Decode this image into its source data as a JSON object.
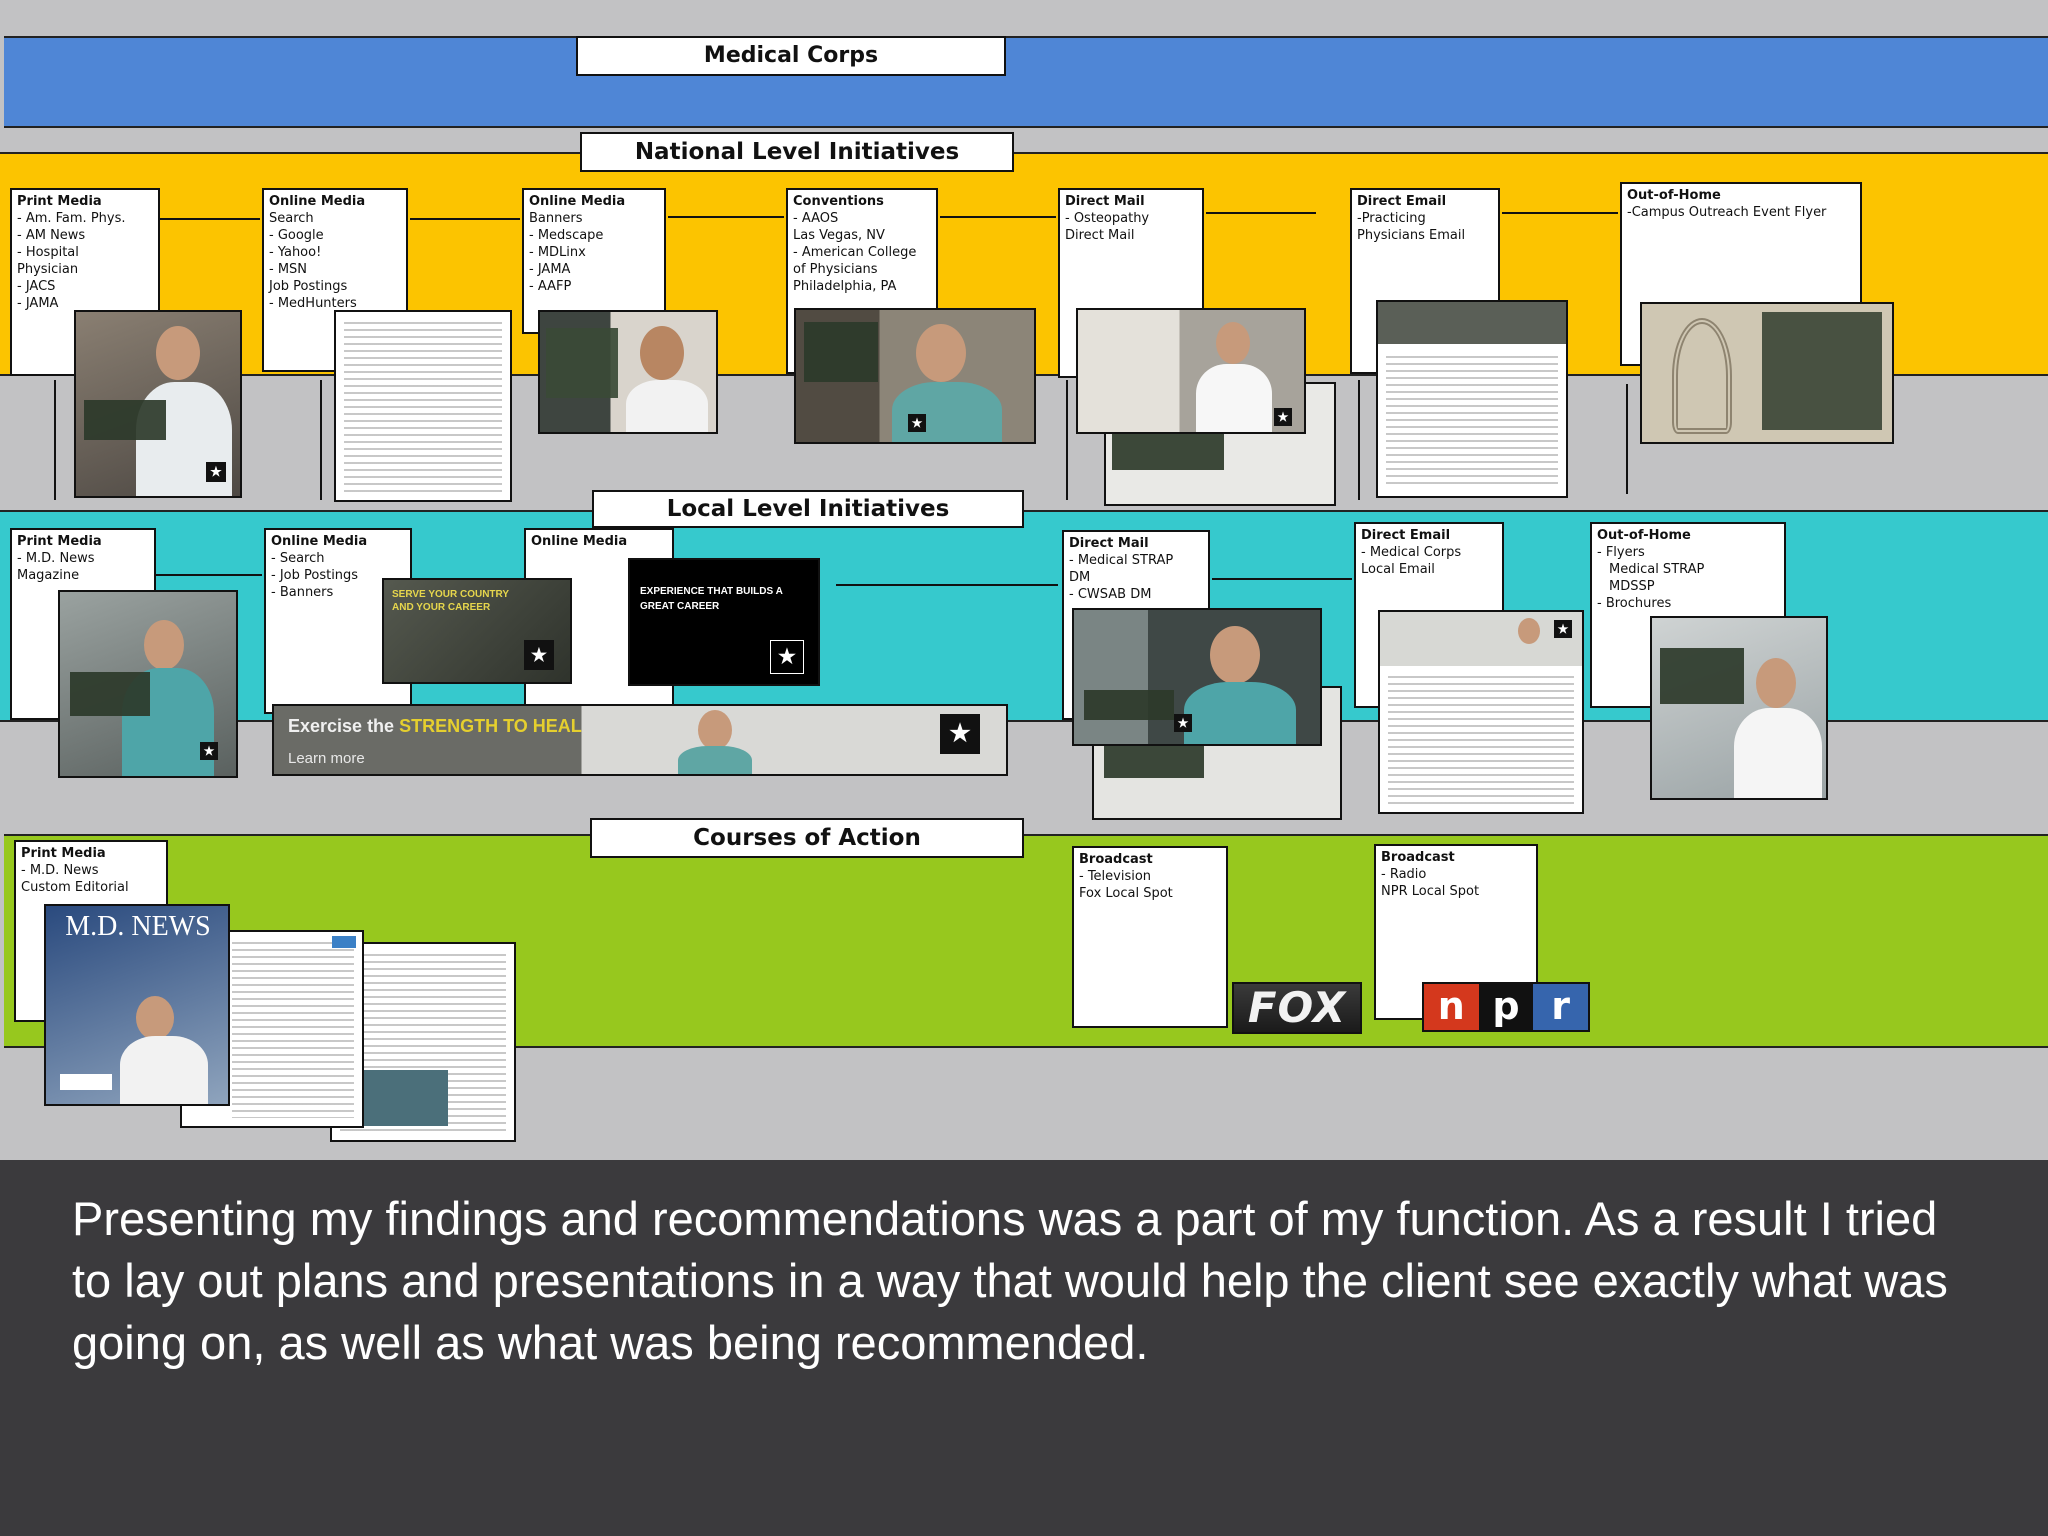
{
  "header": {
    "title": "Medical Corps"
  },
  "colors": {
    "blue": "#4f86d6",
    "yellow": "#fcc400",
    "teal": "#36c9cd",
    "green": "#97c81e",
    "panel_gray": "#c2c2c4",
    "background": "#3b3a3d"
  },
  "national": {
    "title": "National Level Initiatives",
    "print": {
      "heading": "Print Media",
      "lines": [
        "- Am. Fam. Phys.",
        "- AM News",
        "- Hospital",
        "Physician",
        "- JACS",
        "- JAMA"
      ]
    },
    "online1": {
      "heading": "Online Media",
      "lines": [
        "Search",
        "- Google",
        "- Yahoo!",
        "- MSN",
        "Job Postings",
        "- MedHunters"
      ]
    },
    "online2": {
      "heading": "Online Media",
      "lines": [
        "Banners",
        "- Medscape",
        "- MDLinx",
        "- JAMA",
        "- AAFP"
      ]
    },
    "conventions": {
      "heading": "Conventions",
      "lines": [
        "- AAOS",
        "Las Vegas, NV",
        "- American College",
        "of Physicians",
        "Philadelphia, PA"
      ]
    },
    "direct_mail": {
      "heading": "Direct Mail",
      "lines": [
        "- Osteopathy",
        "Direct Mail"
      ]
    },
    "direct_email": {
      "heading": "Direct Email",
      "lines": [
        "-Practicing",
        "Physicians Email"
      ]
    },
    "ooh": {
      "heading": "Out-of-Home",
      "lines": [
        "-Campus Outreach Event Flyer"
      ]
    }
  },
  "local": {
    "title": "Local Level Initiatives",
    "print": {
      "heading": "Print Media",
      "lines": [
        "- M.D. News",
        "Magazine"
      ]
    },
    "online1": {
      "heading": "Online Media",
      "lines": [
        "- Search",
        "- Job Postings",
        "- Banners"
      ]
    },
    "online2": {
      "heading": "Online Media",
      "lines": []
    },
    "direct_mail": {
      "heading": "Direct Mail",
      "lines": [
        "- Medical STRAP",
        "DM",
        "- CWSAB DM"
      ]
    },
    "direct_email": {
      "heading": "Direct Email",
      "lines": [
        "- Medical Corps",
        "Local Email"
      ]
    },
    "ooh": {
      "heading": "Out-of-Home",
      "lines": [
        "- Flyers",
        "Medical STRAP",
        "MDSSP",
        "- Brochures"
      ]
    },
    "banner_a": "SERVE YOUR COUNTRY AND YOUR CAREER",
    "banner_b": "EXPERIENCE THAT BUILDS A GREAT CAREER",
    "long_banner": {
      "lead": "Exercise the",
      "highlight": "STRENGTH TO HEAL",
      "sub": "Learn more"
    }
  },
  "courses": {
    "title": "Courses of Action",
    "print": {
      "heading": "Print Media",
      "lines": [
        "- M.D. News",
        "Custom Editorial"
      ]
    },
    "broadcast_tv": {
      "heading": "Broadcast",
      "lines": [
        "- Television",
        "Fox Local Spot"
      ]
    },
    "broadcast_radio": {
      "heading": "Broadcast",
      "lines": [
        "- Radio",
        "NPR Local Spot"
      ]
    },
    "magazine_title": "M.D. NEWS",
    "fox_logo": "FOX",
    "npr_letters": [
      "n",
      "p",
      "r"
    ]
  },
  "caption": "Presenting my findings and recommendations was a part of my function.  As a result I tried to lay out plans and presentations in a way that would help the client see exactly what was going on, as well as what was being recommended."
}
